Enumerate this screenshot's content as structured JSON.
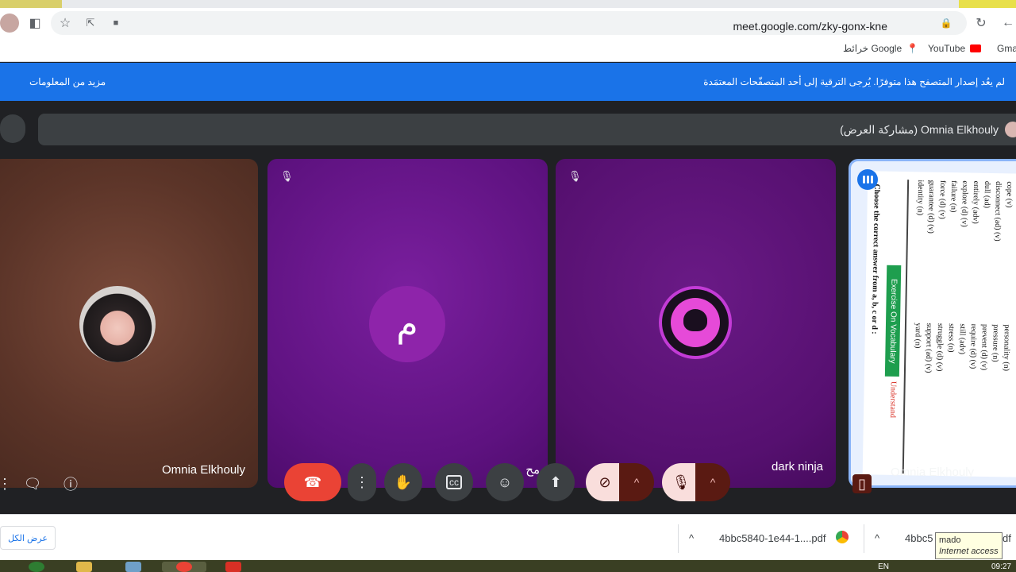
{
  "browser": {
    "url": "meet.google.com/zky-gonx-kne",
    "bookmarks": [
      {
        "label": "Gma"
      },
      {
        "label": "YouTube"
      },
      {
        "label": "خرائط Google"
      }
    ]
  },
  "banner": {
    "message": "لم يعُد إصدار المتصفح هذا متوفرًا. يُرجى الترقية إلى أحد المتصفّحات المعتمَدة",
    "more_link": "مزيد من المعلومات"
  },
  "presenter": {
    "label": "Omnia Elkhouly (مشاركة العرض)"
  },
  "tiles": [
    {
      "name": "Omnia Elkhouly"
    },
    {
      "initial": "م",
      "name": "مح"
    },
    {
      "name": "dark ninja"
    },
    {
      "name": "Omnia Elkhouly"
    }
  ],
  "document": {
    "title": "Choose the correct answer from a, b, c or d :",
    "green_label": "Exercise On Vocabulary",
    "badge": "Understand",
    "columns": [
      "cope (v)",
      "disconnect (ad) (v)",
      "dull (ad)",
      "entirely (adv)",
      "explore (d) (v)",
      "failure (n)",
      "force (d) (v)",
      "guarantee (d) (v)",
      "identity (n)",
      "personality (n)",
      "pressure (n)",
      "prevent (d) (v)",
      "require (d) (v)",
      "still (adv)",
      "stress (n)",
      "struggle (d) (v)",
      "support (ad) (v)",
      "yard (n)"
    ]
  },
  "controls": {
    "end_call": "end-call",
    "more": "more-options",
    "hand": "raise-hand",
    "captions": "captions",
    "emoji": "reactions",
    "present": "present-now",
    "camera": "camera-off",
    "mic": "mic-off"
  },
  "downloads": {
    "show_all": "عرض الكل",
    "items": [
      {
        "file": "4bbc5840-1e44-1....pdf"
      },
      {
        "file": "4bbc5"
      },
      {
        "file": "df"
      }
    ],
    "tooltip_title": "mado",
    "tooltip_sub": "Internet access"
  },
  "taskbar": {
    "time": "09:27",
    "lang": "EN"
  },
  "colors": {
    "banner": "#1a73e8",
    "end_call": "#ea4335",
    "tile_purple": "#5e1280",
    "tile_brown": "#5b3428"
  }
}
